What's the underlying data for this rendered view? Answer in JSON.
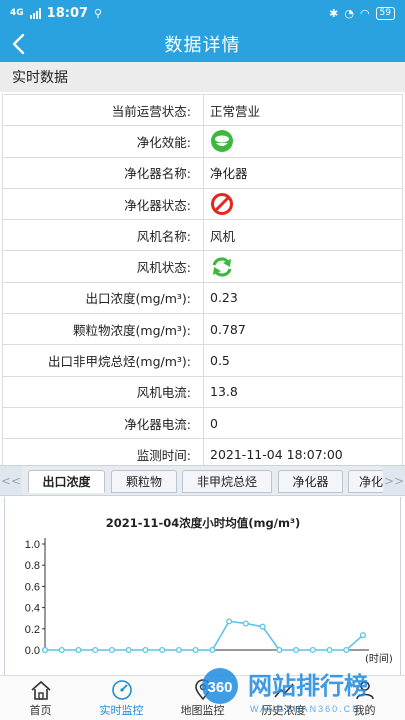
{
  "status_bar": {
    "network": "4G",
    "time": "18:07",
    "battery": "59"
  },
  "header": {
    "title": "数据详情"
  },
  "section": {
    "title": "实时数据"
  },
  "rows": [
    {
      "label": "当前运营状态:",
      "value": "正常营业"
    },
    {
      "label": "净化效能:",
      "icon": "green-face-icon"
    },
    {
      "label": "净化器名称:",
      "value": "净化器"
    },
    {
      "label": "净化器状态:",
      "icon": "red-prohibited-icon"
    },
    {
      "label": "风机名称:",
      "value": "风机"
    },
    {
      "label": "风机状态:",
      "icon": "green-refresh-icon"
    },
    {
      "label": "出口浓度(mg/m³):",
      "value": "0.23"
    },
    {
      "label": "颗粒物浓度(mg/m³):",
      "value": "0.787"
    },
    {
      "label": "出口非甲烷总烃(mg/m³):",
      "value": "0.5"
    },
    {
      "label": "风机电流:",
      "value": "13.8"
    },
    {
      "label": "净化器电流:",
      "value": "0"
    },
    {
      "label": "监测时间:",
      "value": "2021-11-04 18:07:00"
    }
  ],
  "tabs": {
    "prev": "<<",
    "next": ">>",
    "items": [
      "出口浓度",
      "颗粒物",
      "非甲烷总烃",
      "净化器",
      "净化"
    ]
  },
  "chart_data": {
    "type": "line",
    "title": "2021-11-04浓度小时均值(mg/m³)",
    "xlabel": "(时间)",
    "ylabel": "",
    "ylim": [
      0,
      1.0
    ],
    "yticks": [
      "1.0",
      "0.8",
      "0.6",
      "0.4",
      "0.2",
      "0.0"
    ],
    "series": [
      {
        "values": [
          0,
          0,
          0,
          0,
          0,
          0,
          0,
          0,
          0,
          0,
          0,
          0.27,
          0.25,
          0.22,
          0,
          0,
          0,
          0,
          0,
          0.14
        ]
      }
    ],
    "color": "#5bc4e6"
  },
  "bottom_nav": [
    {
      "label": "首页",
      "icon": "home-icon"
    },
    {
      "label": "实时监控",
      "icon": "gauge-icon"
    },
    {
      "label": "地图监控",
      "icon": "map-icon"
    },
    {
      "label": "历史浓度",
      "icon": "history-icon"
    },
    {
      "label": "我的",
      "icon": "user-icon"
    }
  ],
  "watermark": {
    "badge": "360",
    "text": "网站排行榜",
    "sub": "WANGZHAN360.CN"
  }
}
